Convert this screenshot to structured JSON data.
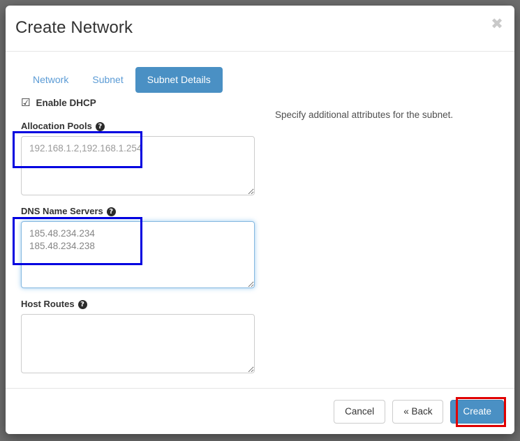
{
  "dialog": {
    "title": "Create Network",
    "close_icon": "close-icon",
    "close_glyph": "✖"
  },
  "tabs": [
    {
      "label": "Network",
      "active": false
    },
    {
      "label": "Subnet",
      "active": false
    },
    {
      "label": "Subnet Details",
      "active": true
    }
  ],
  "form": {
    "dhcp": {
      "label": "Enable DHCP",
      "checked": true,
      "glyph": "☑"
    },
    "fields": [
      {
        "name": "allocation-pools",
        "label": "Allocation Pools",
        "help_icon": "help-circle-icon",
        "help_glyph": "?",
        "value": "",
        "placeholder": "192.168.1.2,192.168.1.254",
        "focused": false
      },
      {
        "name": "dns-name-servers",
        "label": "DNS Name Servers",
        "help_icon": "help-circle-icon",
        "help_glyph": "?",
        "value": "185.48.234.234\n185.48.234.238",
        "placeholder": "",
        "focused": true
      },
      {
        "name": "host-routes",
        "label": "Host Routes",
        "help_icon": "help-circle-icon",
        "help_glyph": "?",
        "value": "",
        "placeholder": "",
        "focused": false
      }
    ]
  },
  "help_text": "Specify additional attributes for the subnet.",
  "footer": {
    "cancel_label": "Cancel",
    "back_label": "« Back",
    "create_label": "Create"
  },
  "colors": {
    "accent": "#4a90c4",
    "tab_link": "#5b9bd5",
    "annotation_blue": "#0000e0",
    "annotation_red": "#e00000",
    "backdrop": "#6e6e6e"
  }
}
